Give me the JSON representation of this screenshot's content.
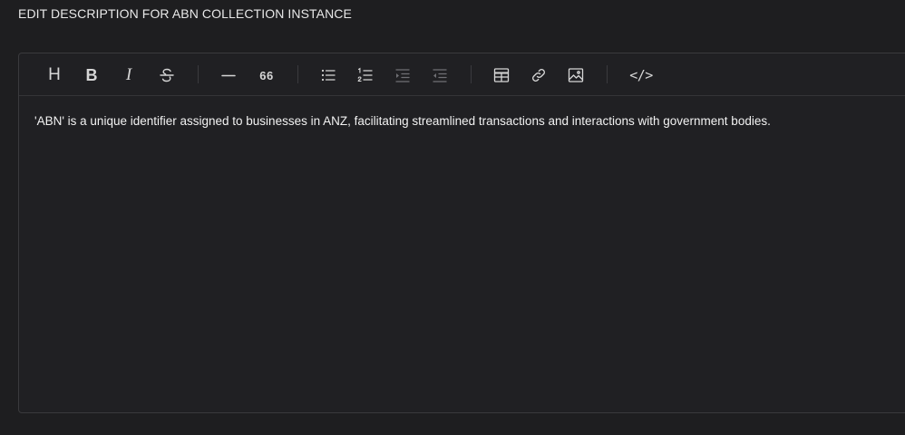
{
  "header": {
    "title": "EDIT DESCRIPTION FOR ABN COLLECTION INSTANCE"
  },
  "toolbar": {
    "tools": [
      {
        "name": "heading",
        "icon": "heading-icon",
        "glyph": "H"
      },
      {
        "name": "bold",
        "icon": "bold-icon",
        "glyph": "B"
      },
      {
        "name": "italic",
        "icon": "italic-icon",
        "glyph": "I"
      },
      {
        "name": "strikethrough",
        "icon": "strikethrough-icon"
      },
      {
        "name": "horizontal-rule",
        "icon": "horizontal-rule-icon"
      },
      {
        "name": "quote",
        "icon": "quote-icon",
        "glyph": "66"
      },
      {
        "name": "bullet-list",
        "icon": "bullet-list-icon"
      },
      {
        "name": "ordered-list",
        "icon": "ordered-list-icon"
      },
      {
        "name": "indent",
        "icon": "indent-icon",
        "disabled": true
      },
      {
        "name": "outdent",
        "icon": "outdent-icon",
        "disabled": true
      },
      {
        "name": "table",
        "icon": "table-icon"
      },
      {
        "name": "link",
        "icon": "link-icon"
      },
      {
        "name": "image",
        "icon": "image-icon"
      },
      {
        "name": "code",
        "icon": "code-icon",
        "glyph": "</>"
      }
    ]
  },
  "editor": {
    "content": "'ABN' is a unique identifier assigned to businesses in ANZ, facilitating streamlined transactions and interactions with government bodies."
  },
  "colors": {
    "background": "#1e1e20",
    "editor_background": "#202023",
    "border": "#3a3a3d",
    "text": "#f2f2f2",
    "icon": "#d6d6d6",
    "icon_disabled": "#6f6f74"
  }
}
